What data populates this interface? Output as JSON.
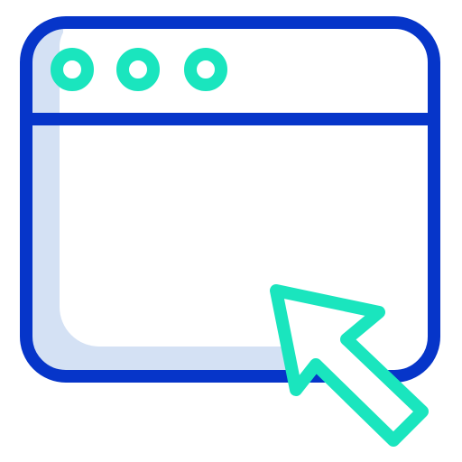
{
  "icon": {
    "name": "browser-window-cursor-icon",
    "colors": {
      "frame": "#0635C9",
      "shadow": "#D4E1F4",
      "accent": "#1AE5BE",
      "background": "#FFFFFF"
    },
    "parts": {
      "window": "browser-window-icon",
      "dots": [
        "window-dot-icon",
        "window-dot-icon",
        "window-dot-icon"
      ],
      "cursor": "mouse-pointer-arrow-icon"
    }
  }
}
